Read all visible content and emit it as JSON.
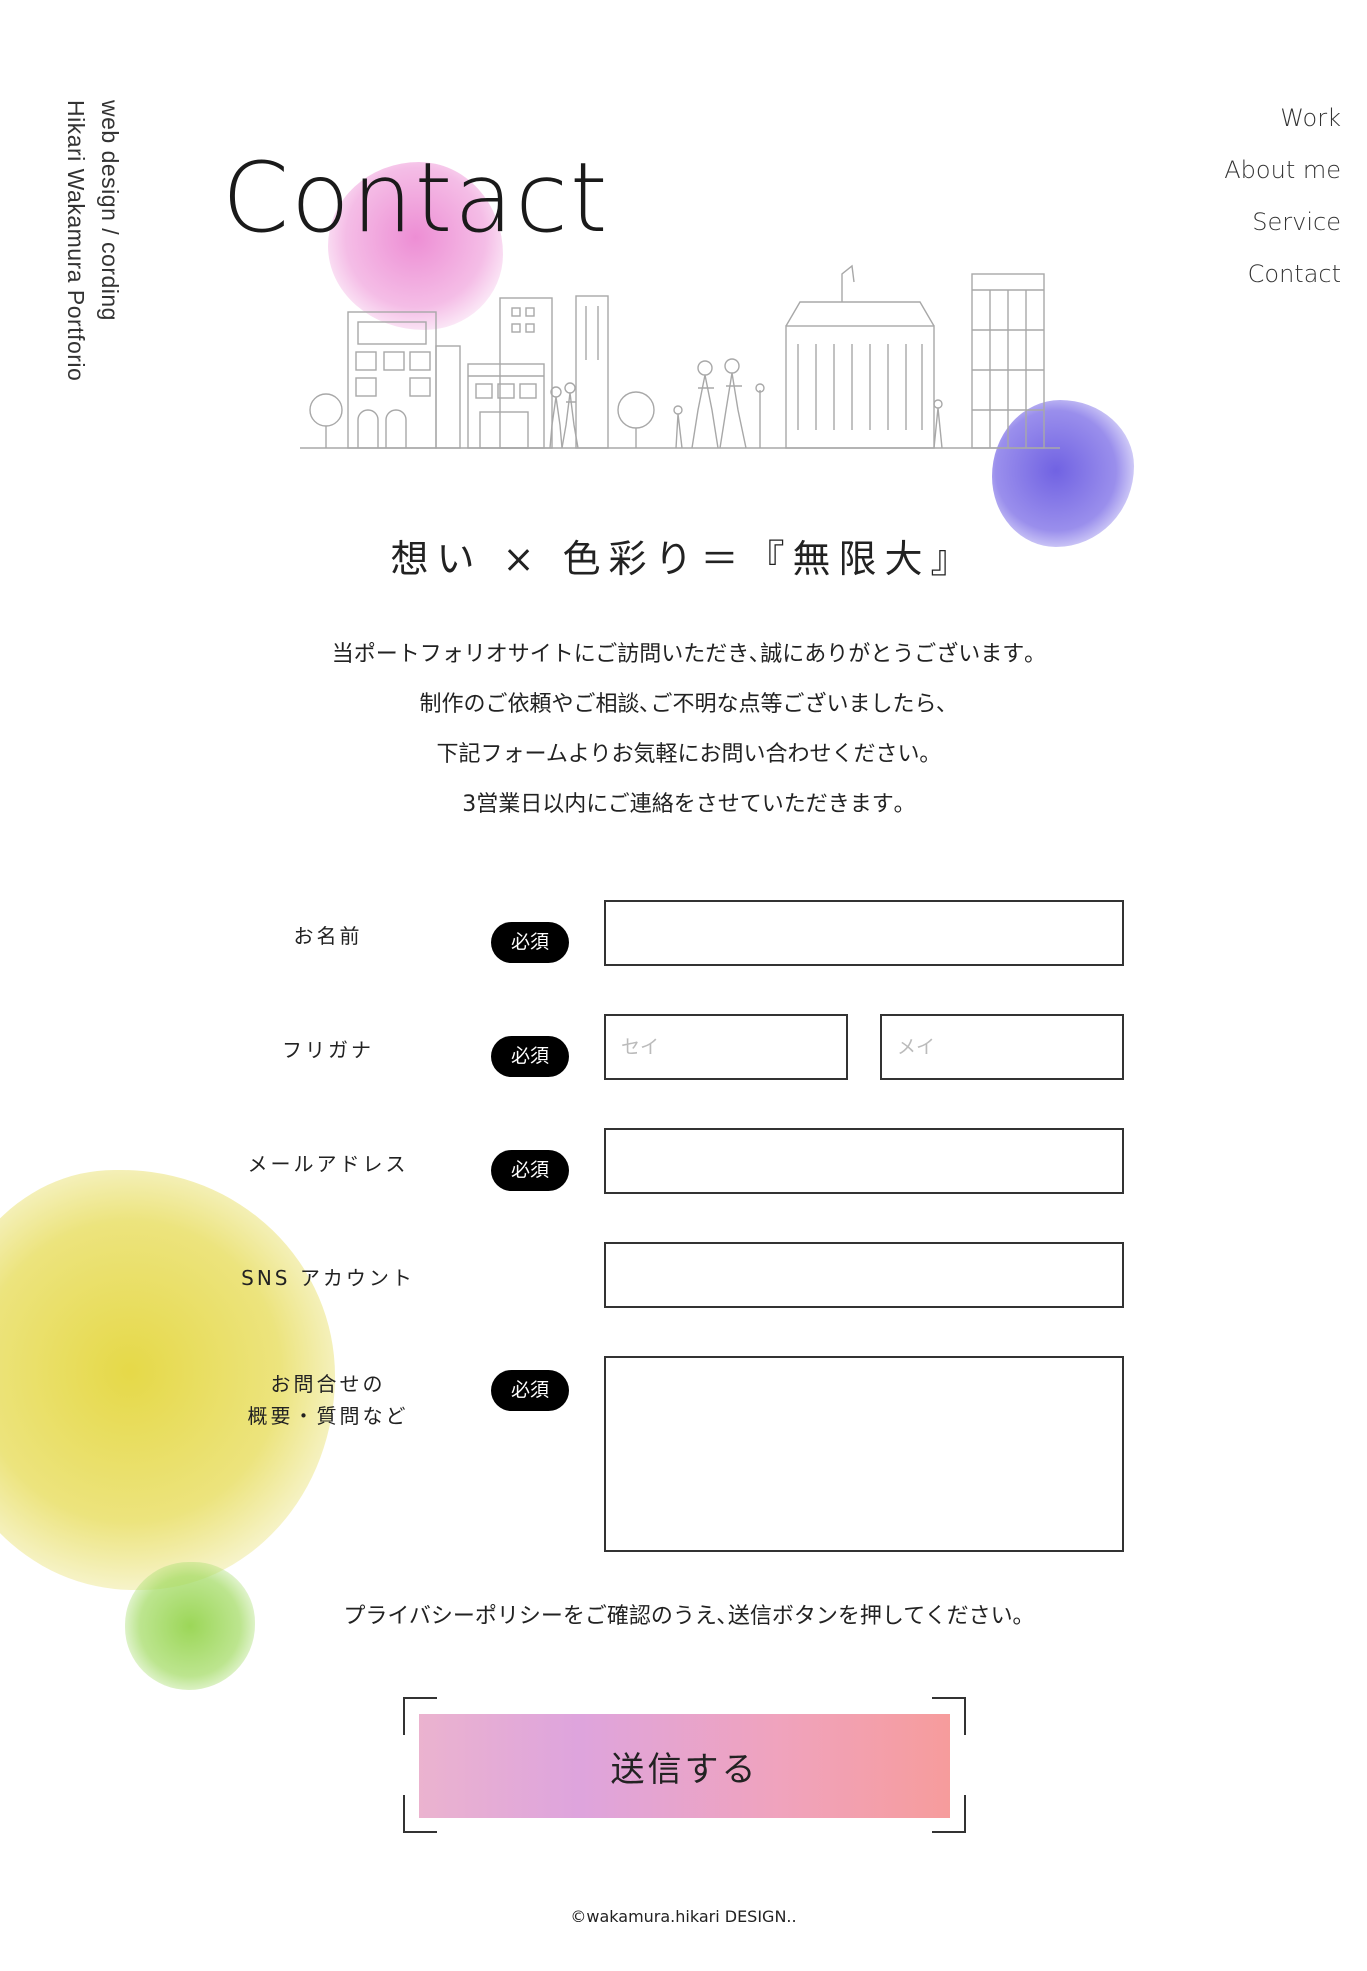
{
  "site": {
    "side_line1": "web design / cording",
    "side_line2": "Hikari Wakamura Portforio"
  },
  "nav": {
    "items": [
      "Work",
      "About me",
      "Service",
      "Contact"
    ]
  },
  "page_title": "Contact",
  "catch_copy": "想い × 色彩り＝『無限大』",
  "intro": {
    "lines": [
      "当ポートフォリオサイトにご訪問いただき､誠にありがとうございます｡",
      "制作のご依頼やご相談､ご不明な点等ございましたら､",
      "下記フォームよりお気軽にお問い合わせください｡",
      "3営業日以内にご連絡をさせていただきます｡"
    ]
  },
  "form": {
    "required_badge": "必須",
    "name_label": "お名前",
    "kana_label": "フリガナ",
    "kana_sei_placeholder": "セイ",
    "kana_mei_placeholder": "メイ",
    "email_label": "メールアドレス",
    "sns_label": "SNS アカウント",
    "inquiry_label_line1": "お問合せの",
    "inquiry_label_line2": "概要・質問など"
  },
  "privacy_note": "プライバシーポリシーをご確認のうえ､送信ボタンを押してください｡",
  "submit_label": "送信する",
  "footer": "©wakamura.hikari DESIGN..",
  "colors": {
    "pink_blob": "#e86ec8",
    "purple_blob": "#695ae1",
    "yellow_blob": "#e1d228",
    "green_blob": "#91d246",
    "badge_bg": "#000000",
    "button_gradient_start": "#ebb3cf",
    "button_gradient_end": "#f69c9c"
  }
}
